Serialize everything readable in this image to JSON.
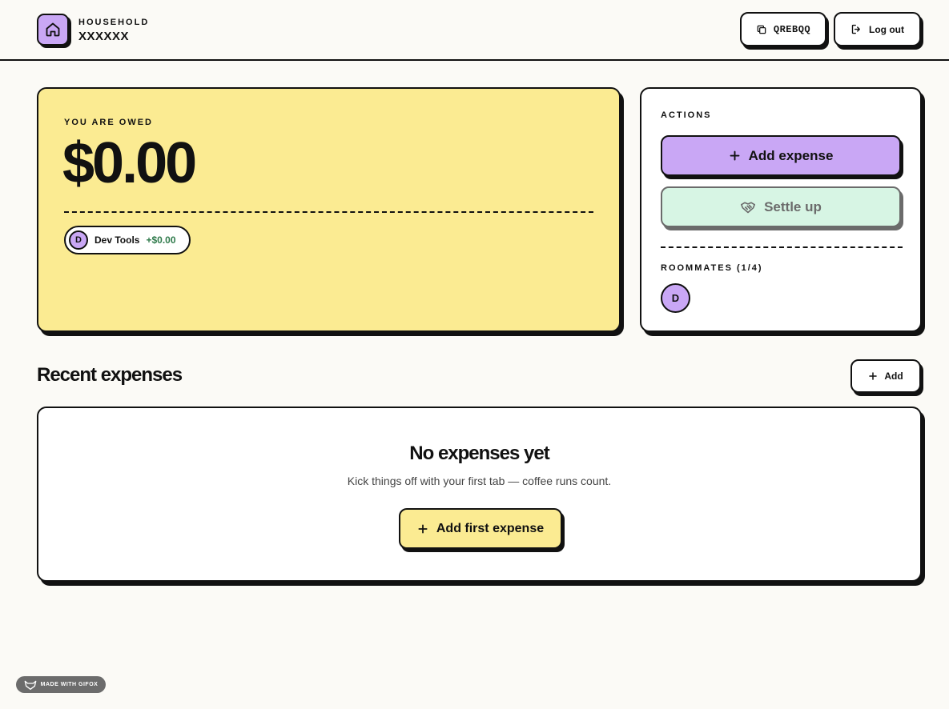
{
  "header": {
    "eyebrow": "HOUSEHOLD",
    "name": "XXXXXX",
    "code_label": "QREBQQ",
    "logout_label": "Log out"
  },
  "balance": {
    "eyebrow": "YOU ARE OWED",
    "amount": "$0.00",
    "members": [
      {
        "initial": "D",
        "name": "Dev Tools",
        "amount": "+$0.00"
      }
    ]
  },
  "actions": {
    "eyebrow": "ACTIONS",
    "add_expense_label": "Add expense",
    "settle_up_label": "Settle up",
    "roommates_eyebrow": "ROOMMATES (1/4)",
    "roommates": [
      {
        "initial": "D"
      }
    ]
  },
  "expenses": {
    "title": "Recent expenses",
    "add_label": "Add",
    "empty_title": "No expenses yet",
    "empty_subtitle": "Kick things off with your first tab — coffee runs count.",
    "first_expense_label": "Add first expense"
  },
  "badge": {
    "label": "MADE WITH GIFOX"
  },
  "colors": {
    "background": "#fbfaf6",
    "owed_card": "#fbeb92",
    "accent_purple": "#c9a7f5",
    "settle_green": "#d7f5e4",
    "positive_amount": "#2f7a4b"
  },
  "icons": {
    "brand": "home-icon",
    "code": "copy-icon",
    "logout": "logout-icon",
    "add": "plus-icon",
    "settle": "handshake-icon",
    "badge": "fox-icon"
  }
}
